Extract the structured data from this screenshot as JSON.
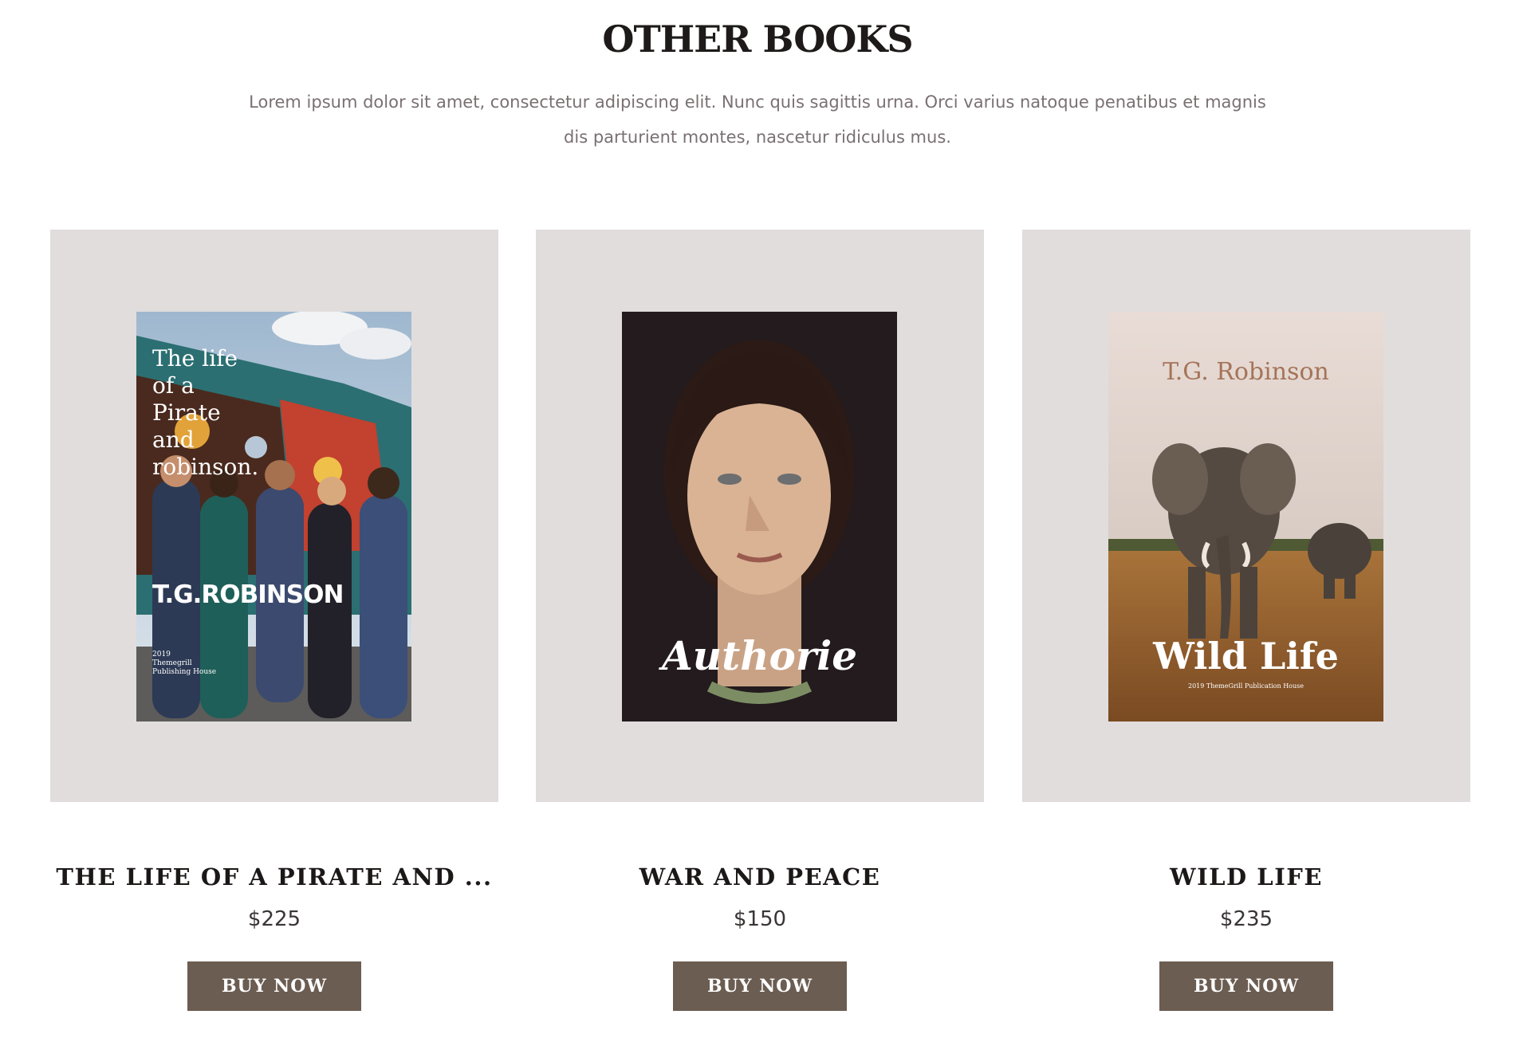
{
  "section": {
    "title": "OTHER BOOKS",
    "intro": "Lorem ipsum dolor sit amet, consectetur adipiscing elit. Nunc quis sagittis urna. Orci varius natoque penatibus et magnis dis parturient montes, nascetur ridiculus mus."
  },
  "books": [
    {
      "title": "THE LIFE OF A PIRATE AND ...",
      "price": "$225",
      "button": "BUY NOW",
      "cover": {
        "title_line1": "The life",
        "title_line2": "of a",
        "title_line3": "Pirate",
        "title_line4": "and",
        "title_line5": "robinson.",
        "author": "T.G.ROBINSON",
        "publisher_line1": "2019",
        "publisher_line2": "Themegrill",
        "publisher_line3": "Publishing House",
        "image": "group-of-friends-photo"
      }
    },
    {
      "title": "WAR AND PEACE",
      "price": "$150",
      "button": "BUY NOW",
      "cover": {
        "title": "Authorie",
        "image": "woman-portrait-photo"
      }
    },
    {
      "title": "WILD LIFE",
      "price": "$235",
      "button": "BUY NOW",
      "cover": {
        "author": "T.G. Robinson",
        "title": "Wild Life",
        "publisher": "2019 ThemeGrill Publication House",
        "image": "elephants-savanna-photo"
      }
    }
  ],
  "colors": {
    "card_background": "#e1dddd",
    "button_background": "#6b5d52",
    "heading": "#1e1a1a",
    "intro_text": "#7a7072"
  }
}
